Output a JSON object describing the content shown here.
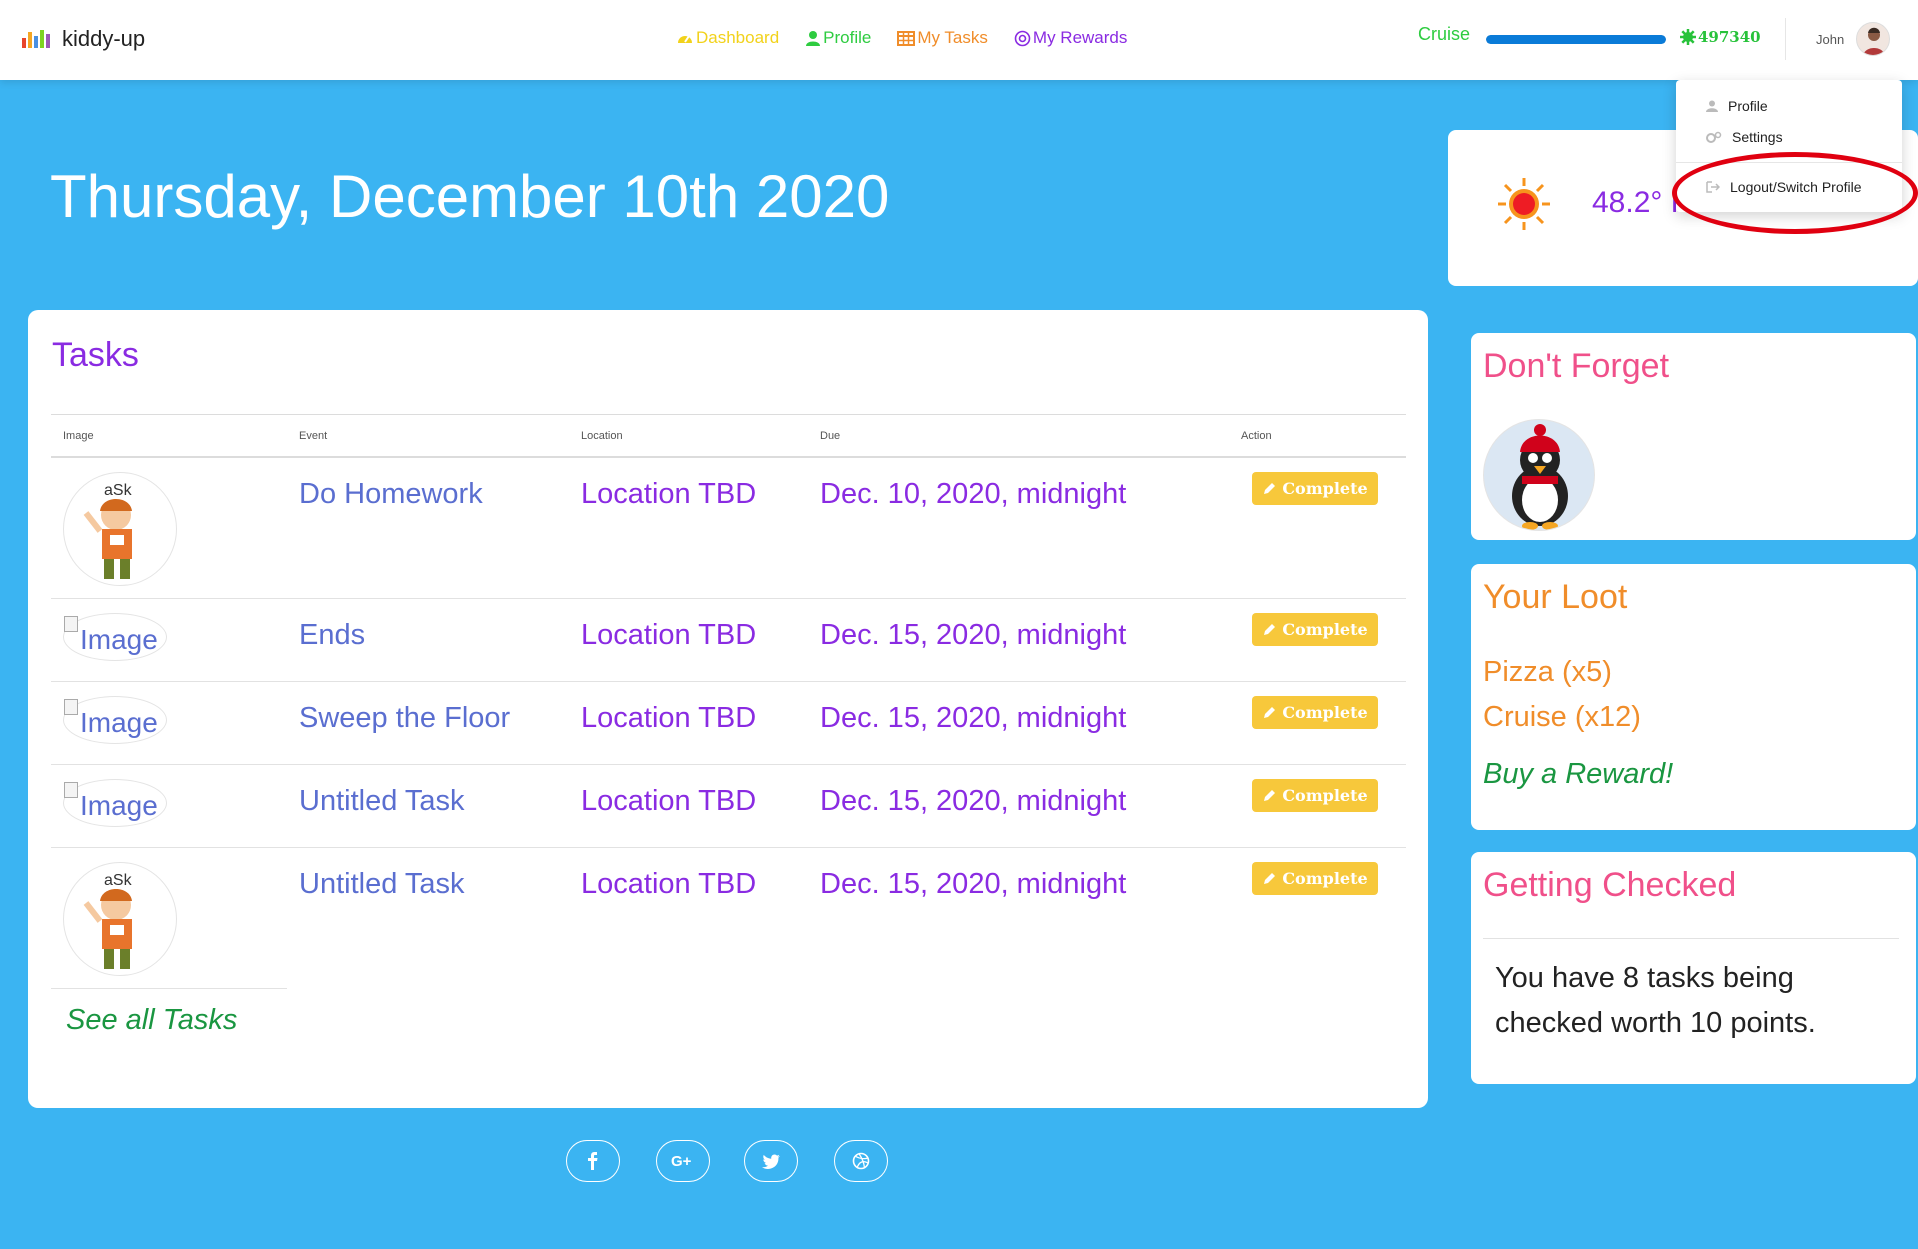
{
  "brand": {
    "name": "kiddy-up"
  },
  "nav": {
    "dashboard": "Dashboard",
    "profile": "Profile",
    "tasks": "My Tasks",
    "rewards": "My Rewards"
  },
  "progress": {
    "label": "Cruise",
    "fraction": 1.0,
    "points": "497340"
  },
  "user": {
    "name": "John"
  },
  "dropdown": {
    "profile": "Profile",
    "settings": "Settings",
    "logout": "Logout/Switch Profile"
  },
  "date_title": "Thursday, December 10th 2020",
  "weather": {
    "temperature": "48.2° F"
  },
  "tasks": {
    "title": "Tasks",
    "headers": {
      "image": "Image",
      "event": "Event",
      "location": "Location",
      "due": "Due",
      "action": "Action"
    },
    "rows": [
      {
        "image_alt": "",
        "event": "Do Homework",
        "location": "Location TBD",
        "due": "Dec. 10, 2020, midnight",
        "action": "Complete"
      },
      {
        "image_alt": "Image",
        "event": "Ends",
        "location": "Location TBD",
        "due": "Dec. 15, 2020, midnight",
        "action": "Complete"
      },
      {
        "image_alt": "Image",
        "event": "Sweep the Floor",
        "location": "Location TBD",
        "due": "Dec. 15, 2020, midnight",
        "action": "Complete"
      },
      {
        "image_alt": "Image",
        "event": "Untitled Task",
        "location": "Location TBD",
        "due": "Dec. 15, 2020, midnight",
        "action": "Complete"
      },
      {
        "image_alt": "",
        "event": "Untitled Task",
        "location": "Location TBD",
        "due": "Dec. 15, 2020, midnight",
        "action": "Complete"
      }
    ],
    "see_all": "See all Tasks"
  },
  "dont_forget": {
    "title": "Don't Forget"
  },
  "loot": {
    "title": "Your Loot",
    "items": [
      "Pizza (x5)",
      "Cruise (x12)"
    ],
    "buy": "Buy a Reward!"
  },
  "checked": {
    "title": "Getting Checked",
    "text": "You have 8 tasks being checked worth 10 points."
  },
  "colors": {
    "background": "#3bb4f2",
    "accent_purple": "#8a2be2",
    "complete_button": "#f7c83b",
    "pink_heading": "#f0508a",
    "orange_heading": "#f08d2a",
    "green_link": "#1a9641"
  },
  "icons": {
    "dashboard": "dashboard-icon",
    "profile": "user-icon",
    "tasks": "table-icon",
    "rewards": "at-sign-icon",
    "points": "gear-icon",
    "weather": "sun-icon",
    "complete": "pencil-icon",
    "social": [
      "facebook-icon",
      "google-plus-icon",
      "twitter-icon",
      "dribbble-icon"
    ]
  }
}
